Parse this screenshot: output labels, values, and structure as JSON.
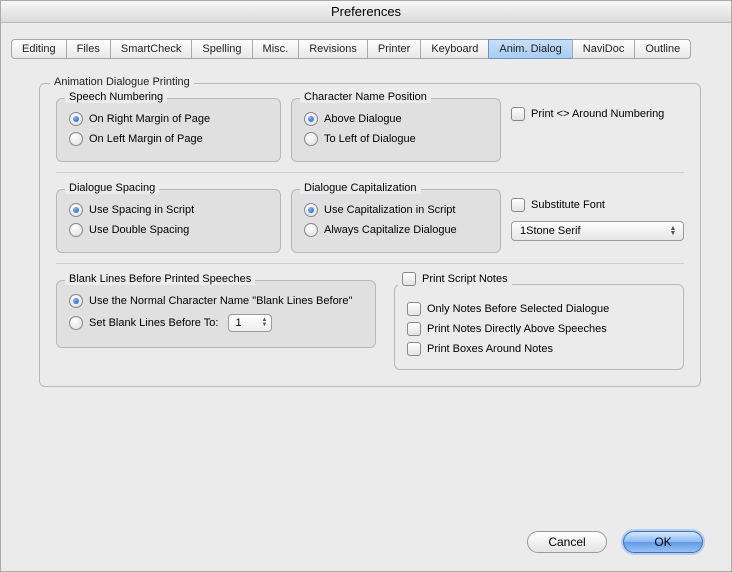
{
  "window": {
    "title": "Preferences"
  },
  "tabs": {
    "editing": "Editing",
    "files": "Files",
    "smartcheck": "SmartCheck",
    "spelling": "Spelling",
    "misc": "Misc.",
    "revisions": "Revisions",
    "printer": "Printer",
    "keyboard": "Keyboard",
    "anim_dialog": "Anim. Dialog",
    "navidoc": "NaviDoc",
    "outline": "Outline"
  },
  "main_group": {
    "title": "Animation Dialogue Printing"
  },
  "speech_numbering": {
    "title": "Speech Numbering",
    "opt_right": "On Right Margin of Page",
    "opt_left": "On Left Margin of Page"
  },
  "char_name_pos": {
    "title": "Character Name Position",
    "opt_above": "Above Dialogue",
    "opt_left": "To Left of Dialogue"
  },
  "print_around_numbering": "Print <> Around Numbering",
  "dialogue_spacing": {
    "title": "Dialogue Spacing",
    "opt_script": "Use Spacing in Script",
    "opt_double": "Use Double Spacing"
  },
  "dialogue_cap": {
    "title": "Dialogue Capitalization",
    "opt_script": "Use Capitalization in Script",
    "opt_always": "Always Capitalize Dialogue"
  },
  "substitute_font": {
    "label": "Substitute Font",
    "value": "1Stone Serif"
  },
  "blank_lines": {
    "title": "Blank Lines Before Printed Speeches",
    "opt_normal": "Use the Normal Character Name \"Blank Lines Before\"",
    "opt_set": "Set Blank Lines Before To:",
    "value": "1"
  },
  "script_notes": {
    "title": "Print Script Notes",
    "opt_only_before": "Only Notes Before Selected Dialogue",
    "opt_directly_above": "Print Notes Directly Above Speeches",
    "opt_boxes": "Print Boxes Around Notes"
  },
  "buttons": {
    "cancel": "Cancel",
    "ok": "OK"
  }
}
